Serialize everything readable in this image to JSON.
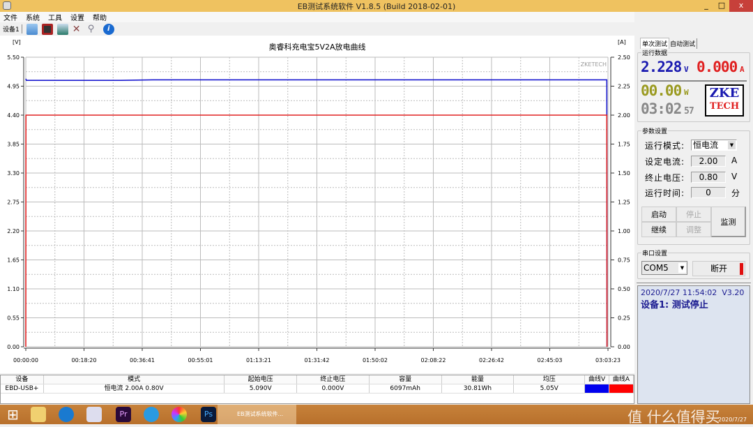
{
  "window": {
    "title": "EB测试系统软件 V1.8.5 (Build 2018-02-01)",
    "minimize": "_",
    "maximize": "□",
    "close": "x"
  },
  "menu": [
    "文件",
    "系统",
    "工具",
    "设置",
    "帮助"
  ],
  "toolbar": {
    "device_label": "设备1",
    "icons": [
      "open-folder-icon",
      "save-icon",
      "chart-image-icon",
      "tools-icon",
      "search-icon",
      "info-icon"
    ]
  },
  "chart_data": {
    "type": "line",
    "title": "奥睿科充电宝5V2A放电曲线",
    "watermark": "ZKETECH",
    "y_left_unit": "[V]",
    "y_right_unit": "[A]",
    "y_left_ticks": [
      "0.00",
      "0.55",
      "1.10",
      "1.65",
      "2.20",
      "2.75",
      "3.30",
      "3.85",
      "4.40",
      "4.95",
      "5.50"
    ],
    "y_right_ticks": [
      "0.00",
      "0.25",
      "0.50",
      "0.75",
      "1.00",
      "1.25",
      "1.50",
      "1.75",
      "2.00",
      "2.25",
      "2.50"
    ],
    "x_ticks": [
      "00:00:00",
      "00:18:20",
      "00:36:41",
      "00:55:01",
      "01:13:21",
      "01:31:42",
      "01:50:02",
      "02:08:22",
      "02:26:42",
      "02:45:03",
      "03:03:23"
    ],
    "ylim_left": [
      0,
      5.5
    ],
    "ylim_right": [
      0,
      2.5
    ],
    "xlim": [
      "00:00:00",
      "03:03:23"
    ],
    "grid": true,
    "series": [
      {
        "axis": "left",
        "color": "#1a1ad0",
        "points": [
          [
            "00:00:00",
            5.09
          ],
          [
            "00:00:10",
            5.06
          ],
          [
            "00:30:00",
            5.06
          ],
          [
            "00:40:00",
            5.07
          ],
          [
            "03:03:00",
            5.07
          ],
          [
            "03:03:05",
            0
          ]
        ]
      },
      {
        "axis": "right",
        "color": "#e02020",
        "points": [
          [
            "00:00:00",
            0
          ],
          [
            "00:00:02",
            2.0
          ],
          [
            "03:03:00",
            2.0
          ],
          [
            "03:03:05",
            0
          ]
        ]
      }
    ]
  },
  "panel": {
    "tabs": [
      "单次测试",
      "自动测试"
    ],
    "run_data_label": "运行数据",
    "voltage": "2.228",
    "voltage_unit": "V",
    "current": "0.000",
    "current_unit": "A",
    "power": "00.00",
    "power_unit": "W",
    "time": "03:02",
    "time_sec": "57",
    "logo_top": "ZKE",
    "logo_bottom": "TECH",
    "params_label": "参数设置",
    "mode_label": "运行模式:",
    "mode_value": "恒电流",
    "current_label": "设定电流:",
    "current_value": "2.00",
    "current_set_unit": "A",
    "cutoff_label": "终止电压:",
    "cutoff_value": "0.80",
    "cutoff_unit": "V",
    "runtime_label": "运行时间:",
    "runtime_value": "0",
    "runtime_unit": "分",
    "btn_start": "启动",
    "btn_stop": "停止",
    "btn_continue": "继续",
    "btn_adjust": "调整",
    "btn_monitor": "监测",
    "serial_label": "串口设置",
    "com_value": "COM5",
    "btn_disconnect": "断开",
    "status_time": "2020/7/27 11:54:02",
    "status_version": "V3.20",
    "status_text": "设备1: 测试停止"
  },
  "table": {
    "headers": [
      "设备",
      "模式",
      "起始电压",
      "终止电压",
      "容量",
      "能量",
      "均压",
      "曲线V",
      "曲线A"
    ],
    "rows": [
      [
        "EBD-USB+",
        "恒电流 2.00A 0.80V",
        "5.090V",
        "0.000V",
        "6097mAh",
        "30.81Wh",
        "5.05V",
        "",
        ""
      ]
    ],
    "curve_colors": [
      "#0000ee",
      "#ff0000"
    ]
  },
  "taskbar": {
    "active_window": "EB测试系统软件...",
    "date": "2020/7/27",
    "watermark": "值 什么值得买"
  }
}
